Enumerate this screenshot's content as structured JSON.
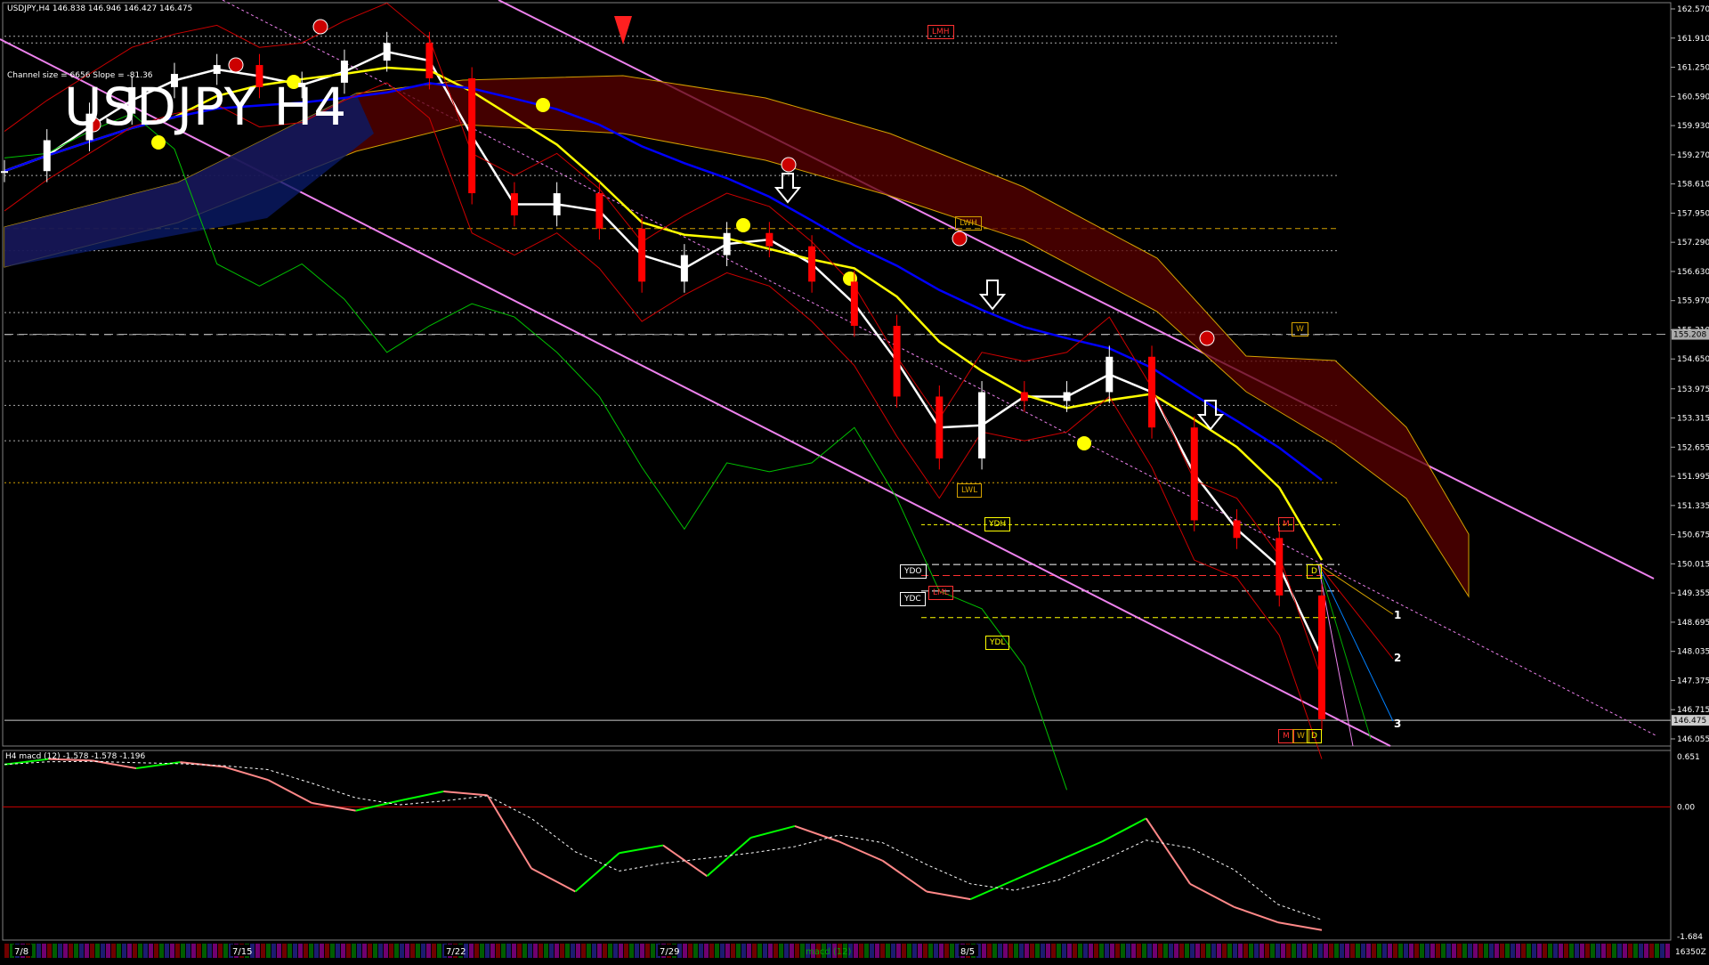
{
  "header": {
    "symbol_line": "USDJPY,H4  146.838 146.946 146.427 146.475",
    "channel_info": "Channel size = 6656 Slope = -81.36",
    "big_title": "USDJPY H4"
  },
  "macd_header": "H4  macd (12) -1.578 -1.578 -1.196",
  "colors": {
    "background": "#000000",
    "bull_candle": "#ffffff",
    "bear_candle": "#ff0000",
    "channel": "#ee82ee",
    "ma_fast": "#ffffff",
    "ma_mid": "#ffff00",
    "ma_slow": "#0000ff",
    "cloud": "#ff0000",
    "lagging": "#00c000",
    "bands": "#cc0000",
    "macd_up": "#00ff00",
    "macd_down": "#ff8888",
    "signal": "#ffffff",
    "zero_line": "#cc0000"
  },
  "price_axis": [
    "162.570",
    "161.910",
    "161.250",
    "160.590",
    "159.930",
    "159.270",
    "158.610",
    "157.950",
    "157.290",
    "156.630",
    "155.970",
    "155.310",
    "154.650",
    "153.975",
    "153.315",
    "152.655",
    "151.995",
    "151.335",
    "150.675",
    "150.015",
    "149.355",
    "148.695",
    "148.035",
    "147.375",
    "146.715",
    "146.055"
  ],
  "current_price": "146.475",
  "level_price": "155.208",
  "macd_axis": [
    "0.651",
    "0.00",
    "-1.684"
  ],
  "macd_bottom_label": "16350Z",
  "time_axis": [
    "7/8",
    "7/15",
    "7/22",
    "7/29",
    "8/5"
  ],
  "level_tags": {
    "lmh": "LMH",
    "lwh": "LWH",
    "w_top": "W",
    "lwl": "LWL",
    "ydh": "YDH",
    "ydo": "YDO",
    "ydc": "YDC",
    "lml": "LML",
    "ydl": "YDL",
    "m1": "M",
    "d1": "D",
    "m2": "M",
    "w2": "W",
    "d2": "D"
  },
  "fan_labels": [
    "1",
    "2",
    "3"
  ],
  "bottom_tab": "macd (12)",
  "chart_data": {
    "type": "line",
    "title": "USDJPY H4",
    "xlabel": "",
    "ylabel": "",
    "x": [
      "7/8",
      "7/15",
      "7/22",
      "7/29",
      "8/5"
    ],
    "ylim": [
      146.055,
      162.57
    ],
    "series": [
      {
        "values": [
          158.9,
          159.6,
          160.2,
          160.8,
          161.1,
          161.3,
          160.8,
          160.9,
          161.4,
          161.8,
          161.0,
          158.4,
          157.9,
          158.4,
          157.6,
          156.4,
          157.0,
          157.5,
          157.2,
          156.4,
          155.4,
          153.8,
          152.4,
          153.9,
          153.7,
          153.9,
          154.7,
          153.1,
          151.0,
          150.6,
          149.3,
          146.5
        ]
      },
      {
        "name": "macd",
        "values": [
          0.55,
          0.62,
          0.6,
          0.5,
          0.58,
          0.52,
          0.35,
          0.05,
          -0.05,
          0.08,
          0.2,
          0.15,
          -0.8,
          -1.1,
          -0.6,
          -0.5,
          -0.9,
          -0.4,
          -0.25,
          -0.45,
          -0.7,
          -1.1,
          -1.2,
          -0.95,
          -0.7,
          -0.45,
          -0.15,
          -1.0,
          -1.3,
          -1.5,
          -1.6
        ]
      }
    ]
  }
}
